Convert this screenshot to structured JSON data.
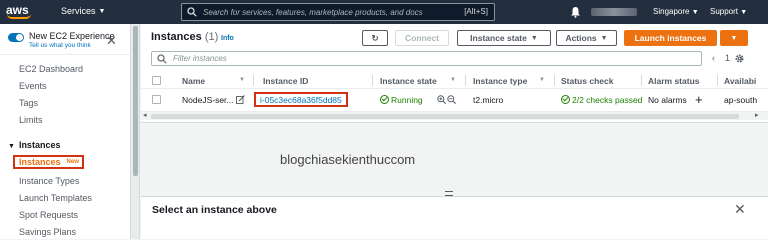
{
  "topnav": {
    "logo": "aws",
    "services_label": "Services",
    "search_placeholder": "Search for services, features, marketplace products, and docs",
    "search_shortcut": "[Alt+S]",
    "region": "Singapore",
    "support": "Support",
    "icons": [
      "search-icon",
      "bell-icon"
    ]
  },
  "sidebar": {
    "new_experience_title": "New EC2 Experience",
    "new_experience_sub": "Tell us what you think",
    "items_top": [
      "EC2 Dashboard",
      "Events",
      "Tags",
      "Limits"
    ],
    "section": "Instances",
    "active_item": "Instances",
    "active_badge": "New",
    "items_bottom": [
      "Instance Types",
      "Launch Templates",
      "Spot Requests",
      "Savings Plans"
    ]
  },
  "panel": {
    "title": "Instances",
    "count": "(1)",
    "info": "Info",
    "buttons": {
      "refresh": "↻",
      "connect": "Connect",
      "instance_state": "Instance state",
      "actions": "Actions",
      "launch": "Launch instances"
    },
    "filter_placeholder": "Filter instances",
    "pager": {
      "prev": "‹",
      "page": "1",
      "next": "›"
    },
    "columns": [
      "Name",
      "Instance ID",
      "Instance state",
      "Instance type",
      "Status check",
      "Alarm status",
      "Availabi"
    ],
    "rows": [
      {
        "name": "NodeJS-ser...",
        "instance_id": "i-05c3ec68a36f5dd85",
        "state": "Running",
        "type": "t2.micro",
        "status_check": "2/2 checks passed",
        "alarm": "No alarms",
        "az": "ap-south"
      }
    ]
  },
  "watermark": "blogchiasekienthuccom",
  "detail": {
    "title": "Select an instance above",
    "close": "✕"
  },
  "colors": {
    "nav_bg": "#232f3e",
    "accent_orange": "#ec7211",
    "link_blue": "#0073bb",
    "success_green": "#1d8102",
    "highlight_red": "#d13212"
  }
}
